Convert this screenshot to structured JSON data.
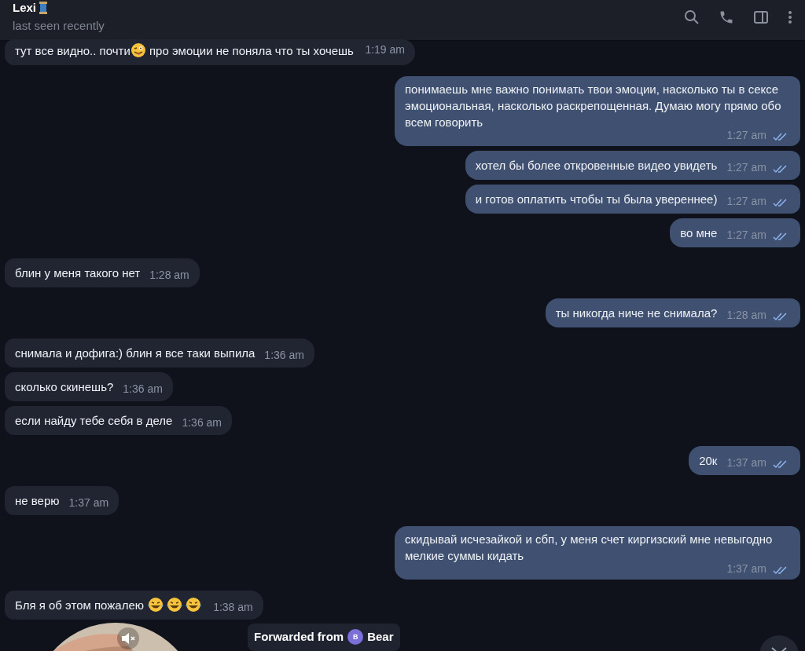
{
  "header": {
    "name": "Lexi",
    "status": "last seen recently"
  },
  "messages": [
    {
      "outgoing": false,
      "parts": [
        {
          "kind": "text",
          "text": "тут все видно.. почти"
        },
        {
          "kind": "wink-emoji"
        },
        {
          "kind": "text",
          "text": " про эмоции не поняла что ты хочешь"
        }
      ],
      "time": "1:19 am"
    },
    {
      "outgoing": true,
      "parts": [
        {
          "kind": "text",
          "text": "понимаешь мне важно понимать твои эмоции, насколько ты в сексе эмоциональная, насколько раскрепощенная. Думаю могу прямо обо всем говорить"
        }
      ],
      "time": "1:27 am",
      "read": true
    },
    {
      "outgoing": true,
      "parts": [
        {
          "kind": "text",
          "text": "хотел бы более откровенные видео увидеть"
        }
      ],
      "time": "1:27 am",
      "read": true
    },
    {
      "outgoing": true,
      "parts": [
        {
          "kind": "text",
          "text": "и готов оплатить чтобы ты была увереннее)"
        }
      ],
      "time": "1:27 am",
      "read": true
    },
    {
      "outgoing": true,
      "parts": [
        {
          "kind": "text",
          "text": "во мне"
        }
      ],
      "time": "1:27 am",
      "read": true
    },
    {
      "outgoing": false,
      "parts": [
        {
          "kind": "text",
          "text": "блин у меня такого нет"
        }
      ],
      "time": "1:28 am"
    },
    {
      "outgoing": true,
      "parts": [
        {
          "kind": "text",
          "text": "ты никогда ниче не снимала?"
        }
      ],
      "time": "1:28 am",
      "read": true
    },
    {
      "outgoing": false,
      "parts": [
        {
          "kind": "text",
          "text": "снимала и дофига:) блин я все таки выпила"
        }
      ],
      "time": "1:36 am"
    },
    {
      "outgoing": false,
      "parts": [
        {
          "kind": "text",
          "text": "сколько скинешь?"
        }
      ],
      "time": "1:36 am"
    },
    {
      "outgoing": false,
      "parts": [
        {
          "kind": "text",
          "text": "если найду тебе себя в деле"
        }
      ],
      "time": "1:36 am"
    },
    {
      "outgoing": true,
      "parts": [
        {
          "kind": "text",
          "text": "20к"
        }
      ],
      "time": "1:37 am",
      "read": true
    },
    {
      "outgoing": false,
      "parts": [
        {
          "kind": "text",
          "text": "не верю"
        }
      ],
      "time": "1:37 am"
    },
    {
      "outgoing": true,
      "parts": [
        {
          "kind": "text",
          "text": "скидывай исчезайкой и сбп, у меня счет киргизский мне невыгодно мелкие суммы кидать"
        }
      ],
      "time": "1:37 am",
      "read": true
    },
    {
      "outgoing": false,
      "parts": [
        {
          "kind": "text",
          "text": "Бля я об этом пожалею "
        },
        {
          "kind": "laugh-emoji"
        },
        {
          "kind": "laugh-emoji"
        },
        {
          "kind": "laugh-emoji"
        }
      ],
      "time": "1:38 am"
    }
  ],
  "forwarded": {
    "label": "Forwarded from",
    "avatar": "B",
    "name": "Bear"
  },
  "video": {
    "kind": "picture",
    "muted": true
  }
}
